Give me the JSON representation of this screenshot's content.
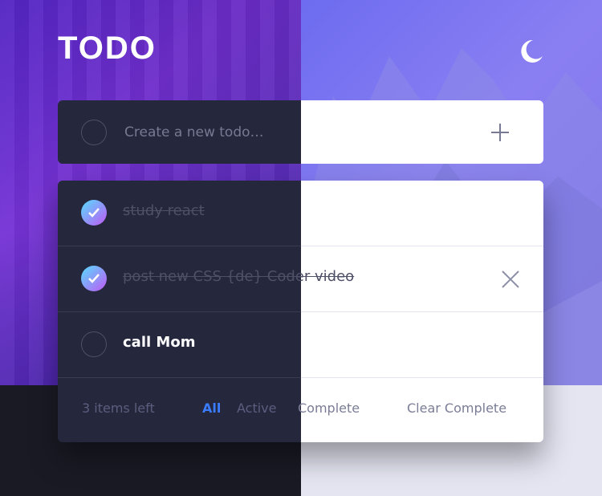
{
  "app": {
    "title": "TODO",
    "theme_icon": "moon-icon"
  },
  "create": {
    "placeholder": "Create a new todo…",
    "value": "",
    "add_icon": "plus-icon"
  },
  "todos": [
    {
      "text": "study react",
      "completed": true
    },
    {
      "text": "post new CSS {de} Coder video",
      "completed": true
    },
    {
      "text": "call Mom",
      "completed": false
    }
  ],
  "footer": {
    "items_left": "3 items left",
    "filters": [
      "All",
      "Active",
      "Complete"
    ],
    "active_filter": "All",
    "clear_label": "Clear Complete"
  },
  "colors": {
    "accent": "#3a7cfd",
    "check_gradient_start": "#57ddff",
    "check_gradient_end": "#c058f3",
    "dark_card": "#25273c",
    "light_card": "#ffffff"
  }
}
